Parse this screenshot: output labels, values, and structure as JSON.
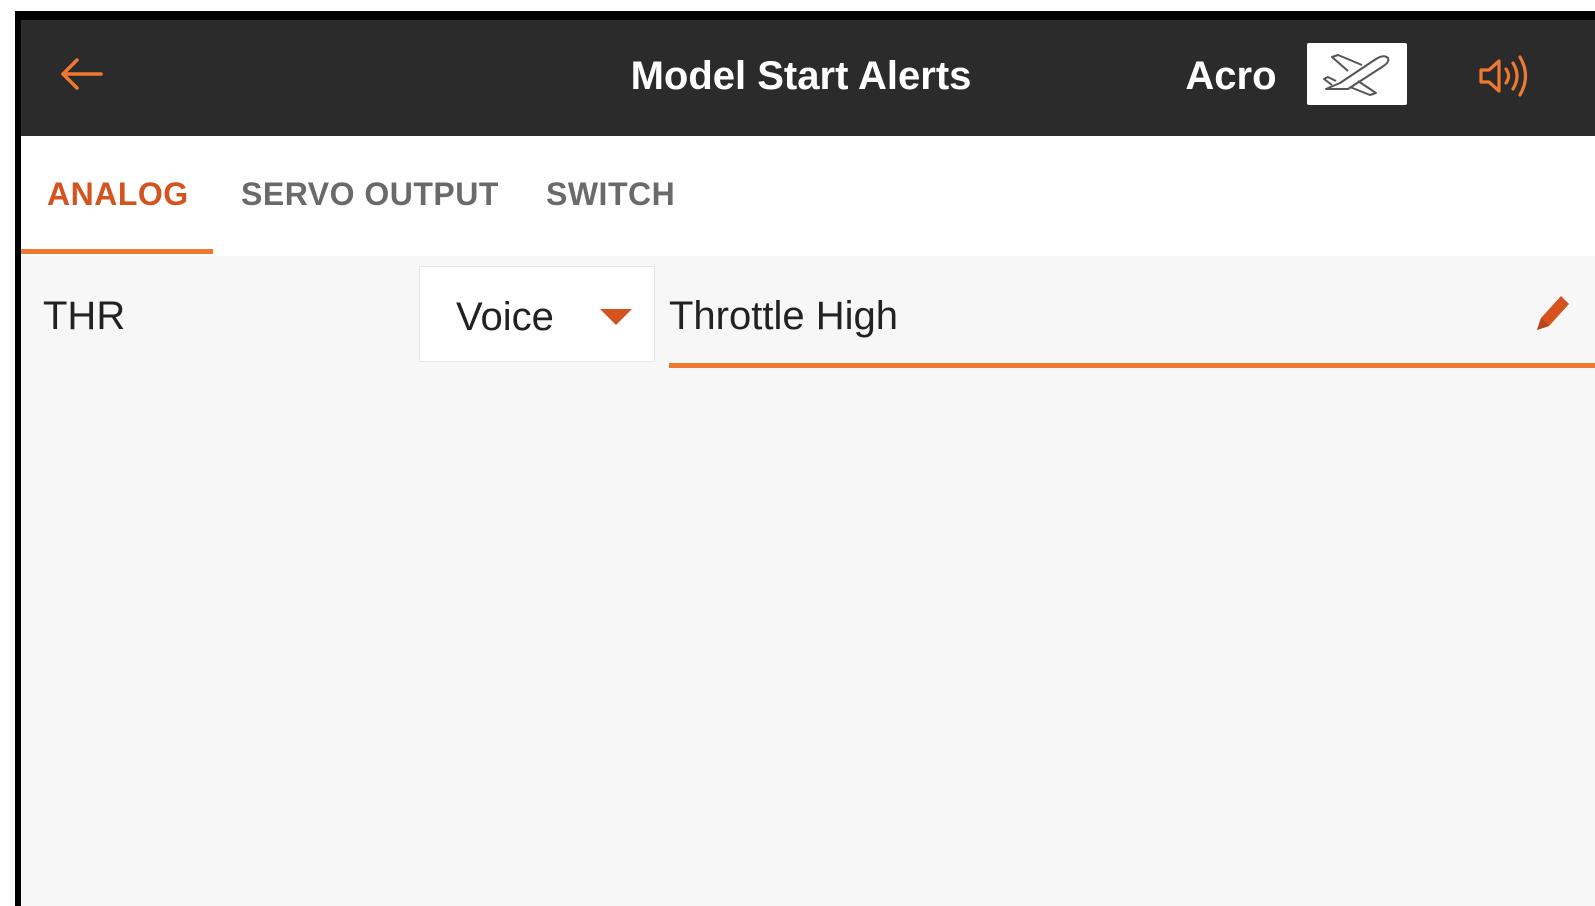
{
  "header": {
    "title": "Model Start Alerts",
    "model_name": "Acro",
    "back_icon": "back-arrow-icon",
    "model_type_icon": "airplane-icon",
    "speaker_icon": "speaker-icon"
  },
  "tabs": [
    {
      "label": "ANALOG",
      "active": true
    },
    {
      "label": "SERVO OUTPUT",
      "active": false
    },
    {
      "label": "SWITCH",
      "active": false
    }
  ],
  "alert_row": {
    "channel": "THR",
    "alert_type": "Voice",
    "alert_text": "Throttle High"
  },
  "colors": {
    "accent": "#ef7930",
    "accent_text": "#d4531f",
    "header_bg": "#2b2b2b",
    "content_bg": "#f7f7f7"
  }
}
